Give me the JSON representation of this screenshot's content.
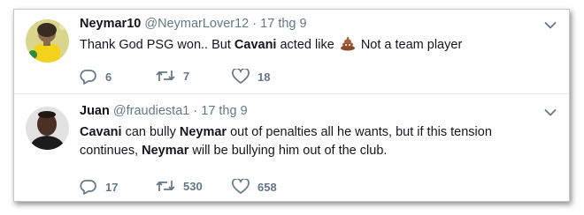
{
  "tweets": [
    {
      "name": "Neymar10",
      "handle": "@NeymarLover12",
      "sep": "·",
      "date": "17 thg 9",
      "text": {
        "p1": "Thank God PSG won.. But ",
        "b1": "Cavani",
        "p2": " acted like ",
        "p3": " Not a team player"
      },
      "emoji": "pile-of-poo",
      "replies": "6",
      "retweets": "7",
      "likes": "18"
    },
    {
      "name": "Juan",
      "handle": "@fraudiesta1",
      "sep": "·",
      "date": "17 thg 9",
      "text": {
        "b1": "Cavani",
        "p1": " can bully ",
        "b2": "Neymar",
        "p2": " out of penalties all he wants, but if this tension continues, ",
        "b3": "Neymar",
        "p3": " will be bullying him out of the club."
      },
      "replies": "17",
      "retweets": "530",
      "likes": "658"
    }
  ],
  "colors": {
    "text": "#14171a",
    "muted": "#657786",
    "divider": "#e6ecf0"
  }
}
